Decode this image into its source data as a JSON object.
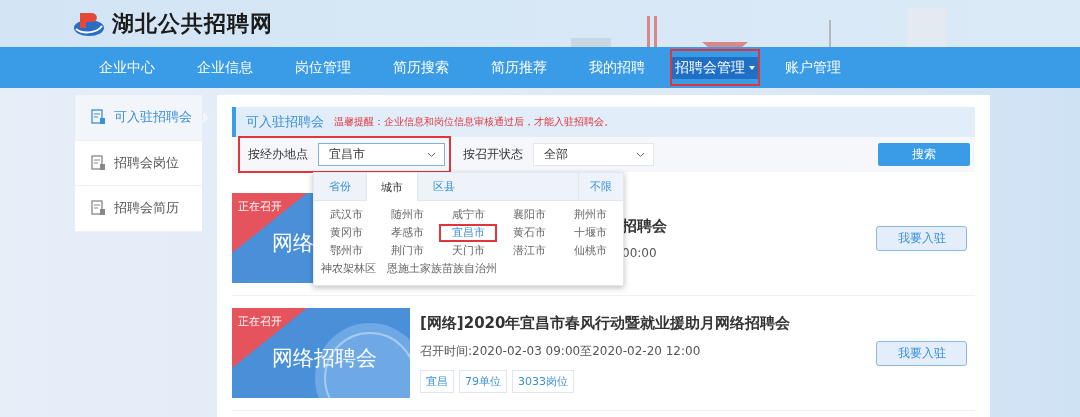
{
  "site": {
    "title": "湖北公共招聘网"
  },
  "nav": [
    {
      "label": "企业中心",
      "selected": false,
      "annotated": false
    },
    {
      "label": "企业信息",
      "selected": false,
      "annotated": false
    },
    {
      "label": "岗位管理",
      "selected": false,
      "annotated": false
    },
    {
      "label": "简历搜索",
      "selected": false,
      "annotated": false
    },
    {
      "label": "简历推荐",
      "selected": false,
      "annotated": false
    },
    {
      "label": "我的招聘",
      "selected": false,
      "annotated": false
    },
    {
      "label": "招聘会管理",
      "selected": true,
      "annotated": true
    },
    {
      "label": "账户管理",
      "selected": false,
      "annotated": false
    }
  ],
  "sidebar": {
    "items": [
      {
        "label": "可入驻招聘会",
        "selected": true
      },
      {
        "label": "招聘会岗位",
        "selected": false
      },
      {
        "label": "招聘会简历",
        "selected": false
      }
    ]
  },
  "section": {
    "title": "可入驻招聘会",
    "notice": "温馨提醒：企业信息和岗位信息审核通过后，才能入驻招聘会。"
  },
  "filters": {
    "location": {
      "label": "按经办地点",
      "value": "宜昌市",
      "annotated": true
    },
    "status": {
      "label": "按召开状态",
      "value": "全部"
    },
    "search_button": "搜索"
  },
  "location_dropdown": {
    "tabs": [
      {
        "label": "省份",
        "selected": false
      },
      {
        "label": "城市",
        "selected": true
      },
      {
        "label": "区县",
        "selected": false
      }
    ],
    "any_label": "不限",
    "options": [
      {
        "label": "武汉市",
        "selected": false
      },
      {
        "label": "随州市",
        "selected": false
      },
      {
        "label": "咸宁市",
        "selected": false
      },
      {
        "label": "襄阳市",
        "selected": false
      },
      {
        "label": "荆州市",
        "selected": false
      },
      {
        "label": "黄冈市",
        "selected": false
      },
      {
        "label": "孝感市",
        "selected": false
      },
      {
        "label": "宜昌市",
        "selected": true
      },
      {
        "label": "黄石市",
        "selected": false
      },
      {
        "label": "十堰市",
        "selected": false
      },
      {
        "label": "鄂州市",
        "selected": false
      },
      {
        "label": "荆门市",
        "selected": false
      },
      {
        "label": "天门市",
        "selected": false
      },
      {
        "label": "潜江市",
        "selected": false
      },
      {
        "label": "仙桃市",
        "selected": false
      },
      {
        "label": "神农架林区",
        "selected": false
      },
      {
        "label": "恩施土家族苗族自治州",
        "selected": false
      }
    ]
  },
  "fairs": [
    {
      "obscured": true,
      "badge": "正在召开",
      "banner": "网络",
      "title": "招聘会",
      "time": "00:00",
      "button": "我要入驻"
    },
    {
      "obscured": false,
      "badge": "正在召开",
      "banner": "网络招聘会",
      "title": "[网络]2020年宜昌市春风行动暨就业援助月网络招聘会",
      "time": "召开时间:2020-02-03 09:00至2020-02-20 12:00",
      "tags": [
        "宜昌",
        "79单位",
        "3033岗位"
      ],
      "button": "我要入驻"
    }
  ]
}
